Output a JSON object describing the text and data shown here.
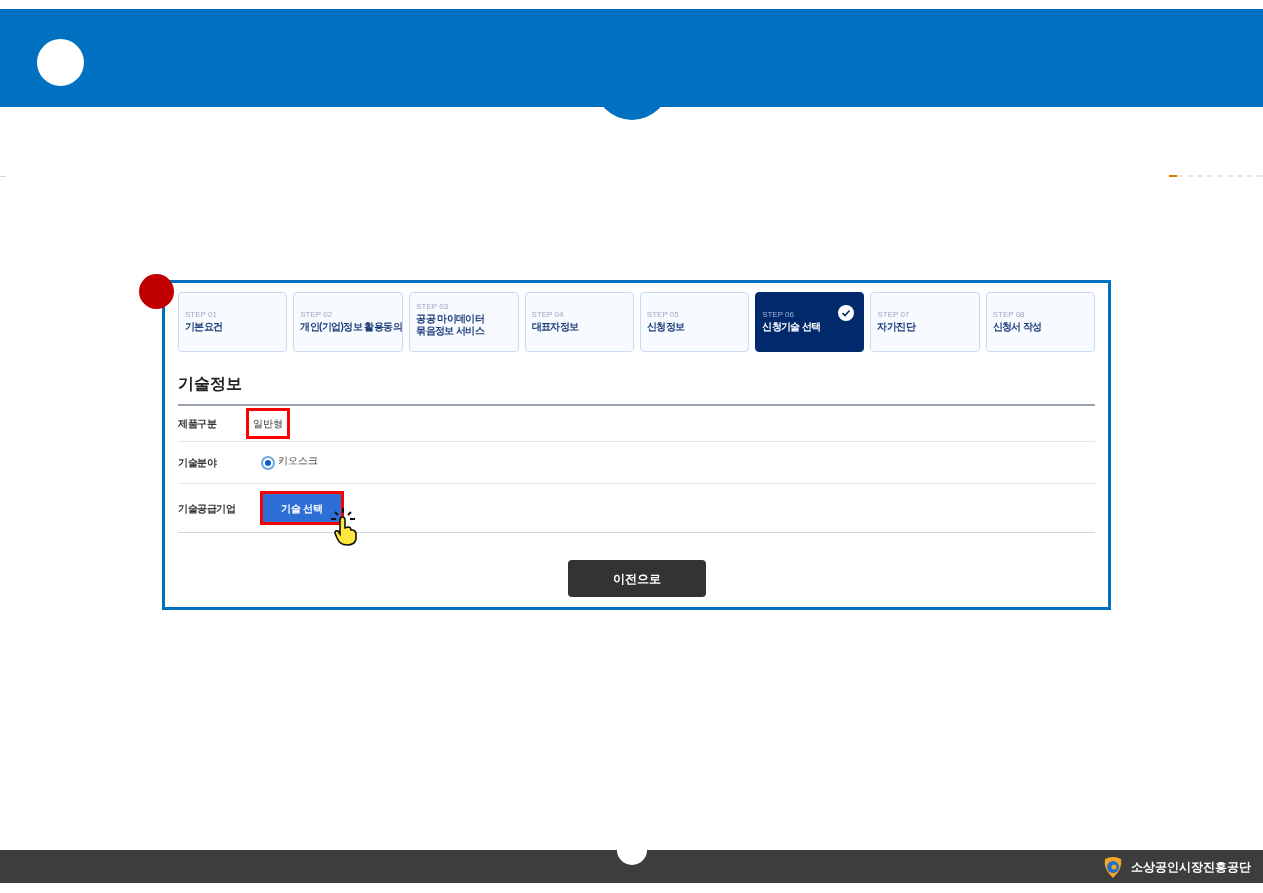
{
  "steps": [
    {
      "label": "STEP 01",
      "title": "기본요건",
      "selected": false
    },
    {
      "label": "STEP 02",
      "title": "개인(기업)정보 활용동의",
      "selected": false
    },
    {
      "label": "STEP 03",
      "title": "공공 마이데이터\n묶음정보 서비스",
      "selected": false
    },
    {
      "label": "STEP 04",
      "title": "대표자정보",
      "selected": false
    },
    {
      "label": "STEP 05",
      "title": "신청정보",
      "selected": false
    },
    {
      "label": "STEP 06",
      "title": "신청기술 선택",
      "selected": true
    },
    {
      "label": "STEP 07",
      "title": "자가진단",
      "selected": false
    },
    {
      "label": "STEP 08",
      "title": "신청서 작성",
      "selected": false
    }
  ],
  "section_title": "기술정보",
  "rows": [
    {
      "kind": "text",
      "label": "제품구분",
      "value": "일반형",
      "highlighted": true
    },
    {
      "kind": "radio",
      "label": "기술분야",
      "value": "키오스크",
      "selected": true
    },
    {
      "kind": "button",
      "label": "기술공급기업",
      "value": "기술 선택",
      "highlighted": true
    }
  ],
  "prev_button": "이전으로",
  "footer": {
    "org": "소상공인시장진흥공단"
  }
}
